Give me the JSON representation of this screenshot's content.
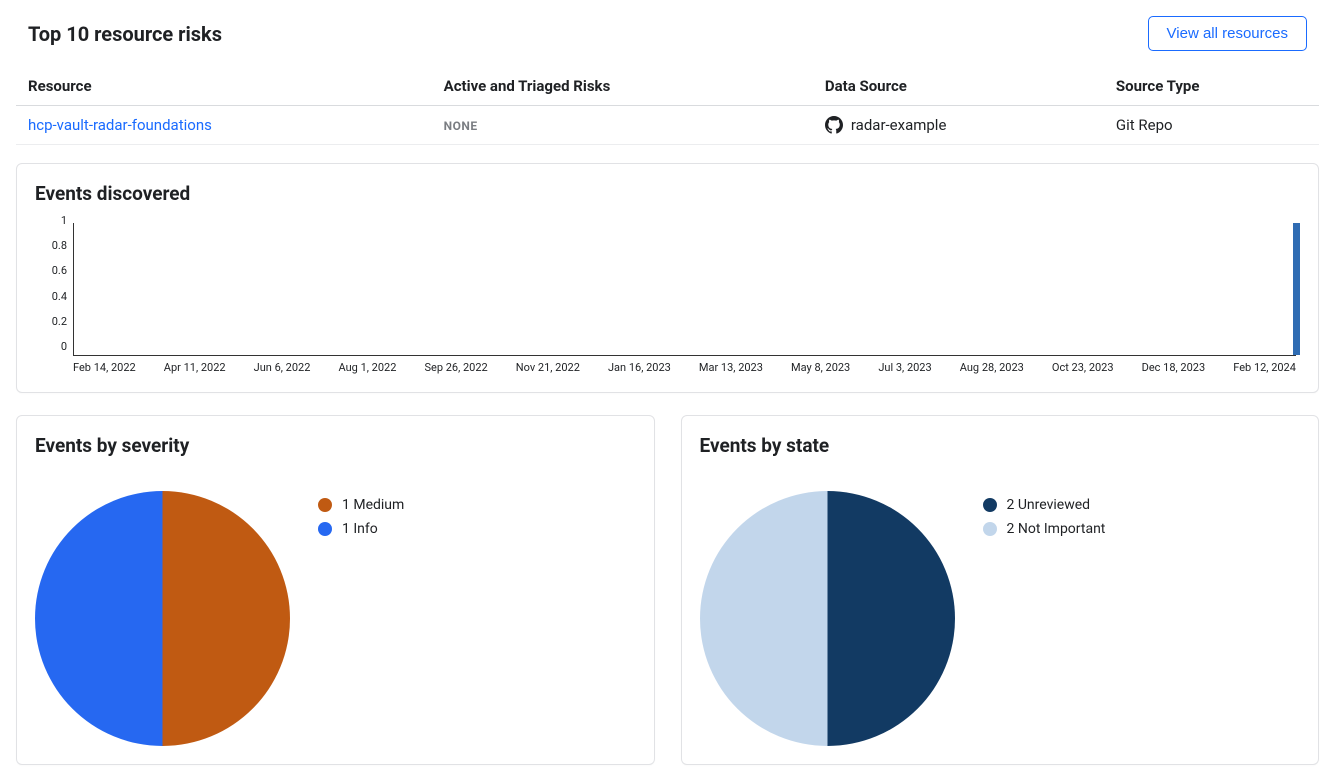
{
  "header": {
    "title": "Top 10 resource risks",
    "view_all": "View all resources"
  },
  "table": {
    "columns": [
      "Resource",
      "Active and Triaged Risks",
      "Data Source",
      "Source Type"
    ],
    "rows": [
      {
        "resource": "hcp-vault-radar-foundations",
        "risks": "NONE",
        "data_source": "radar-example",
        "source_type": "Git Repo"
      }
    ]
  },
  "events_discovered": {
    "title": "Events discovered"
  },
  "chart_data": [
    {
      "type": "bar",
      "title": "Events discovered",
      "x_ticks": [
        "Feb 14, 2022",
        "Apr 11, 2022",
        "Jun 6, 2022",
        "Aug 1, 2022",
        "Sep 26, 2022",
        "Nov 21, 2022",
        "Jan 16, 2023",
        "Mar 13, 2023",
        "May 8, 2023",
        "Jul 3, 2023",
        "Aug 28, 2023",
        "Oct 23, 2023",
        "Dec 18, 2023",
        "Feb 12, 2024"
      ],
      "y_ticks": [
        0,
        0.2,
        0.4,
        0.6,
        0.8,
        1
      ],
      "ylim": [
        0,
        1
      ],
      "series": [
        {
          "name": "events",
          "values": [
            0,
            0,
            0,
            0,
            0,
            0,
            0,
            0,
            0,
            0,
            0,
            0,
            0,
            1
          ]
        }
      ],
      "bar_color": "#2f6cb3"
    },
    {
      "type": "pie",
      "title": "Events by severity",
      "labels": [
        "Medium",
        "Info"
      ],
      "values": [
        1,
        1
      ],
      "legend_labels": [
        "1 Medium",
        "1 Info"
      ],
      "colors": [
        "#c05a12",
        "#2668f1"
      ]
    },
    {
      "type": "pie",
      "title": "Events by state",
      "labels": [
        "Unreviewed",
        "Not Important"
      ],
      "values": [
        2,
        2
      ],
      "legend_labels": [
        "2 Unreviewed",
        "2 Not Important"
      ],
      "colors": [
        "#123a63",
        "#c2d6eb"
      ]
    }
  ],
  "severity": {
    "title": "Events by severity"
  },
  "state": {
    "title": "Events by state"
  }
}
